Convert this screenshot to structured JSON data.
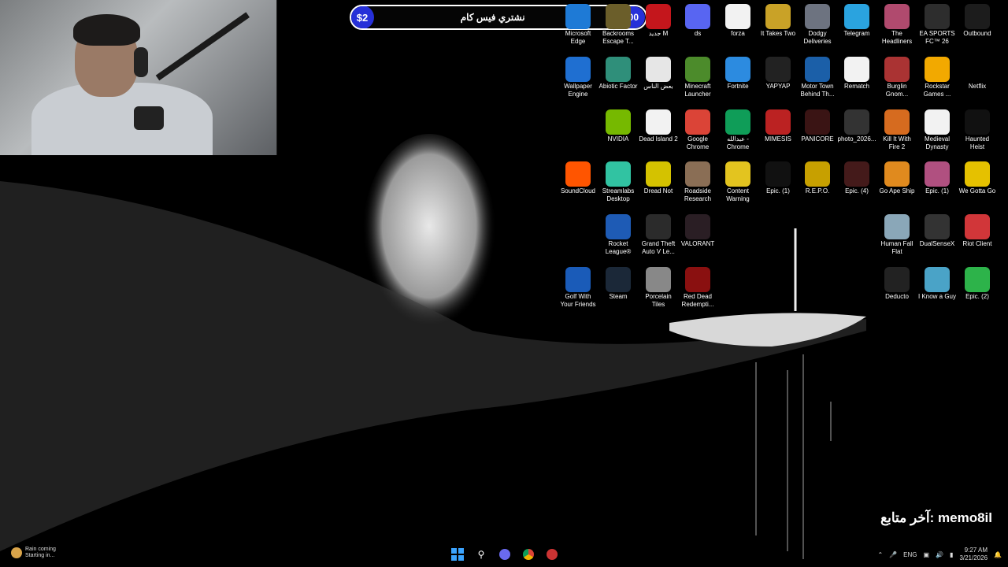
{
  "donation_bar": {
    "left_amount": "$2",
    "goal_text": "نشتري فيس كام",
    "right_amount": "$100"
  },
  "desktop_icons": [
    {
      "id": "edge",
      "label": "Microsoft Edge",
      "icon": "edge-icon",
      "color": "#1e7ad6"
    },
    {
      "id": "backrooms",
      "label": "Backrooms Escape T...",
      "icon": "backrooms-icon",
      "color": "#6b5e2a"
    },
    {
      "id": "acrobat",
      "label": "جديد M",
      "icon": "acrobat-icon",
      "color": "#c4161c"
    },
    {
      "id": "discord",
      "label": "ds",
      "icon": "discord-icon",
      "color": "#5865f2"
    },
    {
      "id": "forza",
      "label": "forza",
      "icon": "file-icon",
      "color": "#f2f2f2"
    },
    {
      "id": "ittakestwo",
      "label": "It Takes Two",
      "icon": "game-icon",
      "color": "#c9a227"
    },
    {
      "id": "dodgy",
      "label": "Dodgy Deliveries",
      "icon": "game-icon",
      "color": "#6d7380"
    },
    {
      "id": "telegram",
      "label": "Telegram",
      "icon": "telegram-icon",
      "color": "#2aa3df"
    },
    {
      "id": "headliners",
      "label": "The Headliners",
      "icon": "game-icon",
      "color": "#b04a6e"
    },
    {
      "id": "easports",
      "label": "EA SPORTS FC™ 26",
      "icon": "game-icon",
      "color": "#2d2d2d"
    },
    {
      "id": "outbound",
      "label": "Outbound",
      "icon": "game-icon",
      "color": "#1c1c1c"
    },
    {
      "id": "wallpaperengine",
      "label": "Wallpaper Engine",
      "icon": "wallpaper-engine-icon",
      "color": "#1f6fd1"
    },
    {
      "id": "abiotic",
      "label": "Abiotic Factor",
      "icon": "game-icon",
      "color": "#2f8f7a"
    },
    {
      "id": "file_ar",
      "label": "بعض الناس",
      "icon": "file-icon",
      "color": "#e6e6e6"
    },
    {
      "id": "minecraft",
      "label": "Minecraft Launcher",
      "icon": "minecraft-icon",
      "color": "#4c8b2b"
    },
    {
      "id": "fortnite",
      "label": "Fortnite",
      "icon": "fortnite-icon",
      "color": "#2c8be0"
    },
    {
      "id": "yapyap",
      "label": "YAPYAP",
      "icon": "game-icon",
      "color": "#222"
    },
    {
      "id": "motortown",
      "label": "Motor Town Behind Th...",
      "icon": "game-icon",
      "color": "#1b5fa8"
    },
    {
      "id": "rematch",
      "label": "Rematch",
      "icon": "file-icon",
      "color": "#f2f2f2"
    },
    {
      "id": "burglin",
      "label": "Burglin Gnom...",
      "icon": "game-icon",
      "color": "#a33"
    },
    {
      "id": "rockstar",
      "label": "Rockstar Games ...",
      "icon": "rockstar-icon",
      "color": "#f2a900"
    },
    {
      "id": "netflix",
      "label": "Netflix",
      "icon": "netflix-icon",
      "color": "#000"
    },
    {
      "id": "nvidia",
      "label": "NVIDIA",
      "icon": "nvidia-icon",
      "color": "#76b900"
    },
    {
      "id": "deadisland",
      "label": "Dead Island 2",
      "icon": "file-icon",
      "color": "#f2f2f2"
    },
    {
      "id": "chrome",
      "label": "Google Chrome",
      "icon": "chrome-icon",
      "color": "#db4437"
    },
    {
      "id": "chrome2",
      "label": "عبدالله - Chrome",
      "icon": "chrome-icon",
      "color": "#0f9d58"
    },
    {
      "id": "mimesis",
      "label": "MIMESIS",
      "icon": "game-icon",
      "color": "#b22"
    },
    {
      "id": "panicore",
      "label": "PANICORE",
      "icon": "game-icon",
      "color": "#3a1414"
    },
    {
      "id": "photo",
      "label": "photo_2026...",
      "icon": "image-icon",
      "color": "#333"
    },
    {
      "id": "killitwithfire",
      "label": "Kill It With Fire 2",
      "icon": "game-icon",
      "color": "#d66b1f"
    },
    {
      "id": "medieval",
      "label": "Medieval Dynasty",
      "icon": "file-icon",
      "color": "#f2f2f2"
    },
    {
      "id": "hauntedheist",
      "label": "Haunted Heist",
      "icon": "diamond-icon",
      "color": "#111"
    },
    {
      "id": "soundcloud",
      "label": "SoundCloud",
      "icon": "soundcloud-icon",
      "color": "#ff5500"
    },
    {
      "id": "streamlabs",
      "label": "Streamlabs Desktop",
      "icon": "streamlabs-icon",
      "color": "#31c3a2"
    },
    {
      "id": "dreadnot",
      "label": "Dread Not",
      "icon": "game-icon",
      "color": "#d4c200"
    },
    {
      "id": "roadside",
      "label": "Roadside Research",
      "icon": "game-icon",
      "color": "#8a6e55"
    },
    {
      "id": "contentwarning",
      "label": "Content Warning",
      "icon": "game-icon",
      "color": "#e3c41f"
    },
    {
      "id": "epic1",
      "label": "Epic. (1)",
      "icon": "epic-icon",
      "color": "#111"
    },
    {
      "id": "repo",
      "label": "R.E.P.O.",
      "icon": "game-icon",
      "color": "#c7a000"
    },
    {
      "id": "epic4",
      "label": "Epic. (4)",
      "icon": "game-icon",
      "color": "#441a1a"
    },
    {
      "id": "goape",
      "label": "Go Ape Ship",
      "icon": "game-icon",
      "color": "#e08a1e"
    },
    {
      "id": "epic1b",
      "label": "Epic. (1)",
      "icon": "game-icon",
      "color": "#b05080"
    },
    {
      "id": "wegottago",
      "label": "We Gotta Go",
      "icon": "game-icon",
      "color": "#e5c100"
    },
    {
      "id": "rocketleague",
      "label": "Rocket League®",
      "icon": "rocket-league-icon",
      "color": "#1e5bb5"
    },
    {
      "id": "gta",
      "label": "Grand Theft Auto V Le...",
      "icon": "gta-icon",
      "color": "#2b2b2b"
    },
    {
      "id": "valorant",
      "label": "VALORANT",
      "icon": "valorant-icon",
      "color": "#2a1e24"
    },
    {
      "id": "humanfall",
      "label": "Human Fall Flat",
      "icon": "game-icon",
      "color": "#8aa7b8"
    },
    {
      "id": "dualsense",
      "label": "DualSenseX",
      "icon": "controller-icon",
      "color": "#333"
    },
    {
      "id": "riot",
      "label": "Riot Client",
      "icon": "riot-icon",
      "color": "#d13639"
    },
    {
      "id": "golf",
      "label": "Golf With Your Friends",
      "icon": "golf-icon",
      "color": "#1a5bb8"
    },
    {
      "id": "steam",
      "label": "Steam",
      "icon": "steam-icon",
      "color": "#1b2838"
    },
    {
      "id": "porcelain",
      "label": "Porcelain Tiles",
      "icon": "game-icon",
      "color": "#888"
    },
    {
      "id": "rdr",
      "label": "Red Dead Redempti...",
      "icon": "game-icon",
      "color": "#8a1010"
    },
    {
      "id": "deducto",
      "label": "Deducto",
      "icon": "game-icon",
      "color": "#222"
    },
    {
      "id": "iknowaguy",
      "label": "I Know a Guy",
      "icon": "game-icon",
      "color": "#4aa3c7"
    },
    {
      "id": "epic2",
      "label": "Epic. (2)",
      "icon": "game-icon",
      "color": "#2db34a"
    }
  ],
  "follower": {
    "name": "memo8il",
    "label": "آخر متابع:"
  },
  "taskbar": {
    "weather_line1": "Rain coming",
    "weather_line2": "Starting in...",
    "lang": "ENG",
    "time": "9:27 AM",
    "date": "3/21/2026"
  }
}
